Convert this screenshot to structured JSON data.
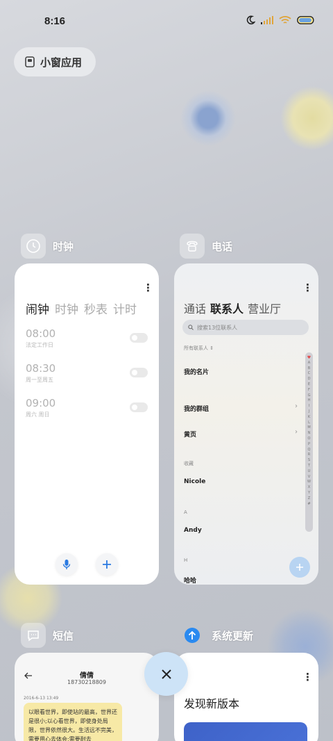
{
  "status": {
    "time": "8:16"
  },
  "floating_windows": {
    "label": "小窗应用"
  },
  "cards": {
    "clock": {
      "title": "时钟",
      "tabs": [
        "闹钟",
        "时钟",
        "秒表",
        "计时"
      ],
      "alarms": [
        {
          "time": "08:00",
          "repeat": "法定工作日"
        },
        {
          "time": "08:30",
          "repeat": "周一至周五"
        },
        {
          "time": "09:00",
          "repeat": "周六 周日"
        }
      ]
    },
    "phone": {
      "title": "电话",
      "tabs": [
        "通话",
        "联系人",
        "营业厅"
      ],
      "search_placeholder": "搜索13位联系人",
      "all_contacts": "所有联系人",
      "my_card": "我的名片",
      "my_groups": "我的群组",
      "yellow_pages": "黄页",
      "favorites_header": "收藏",
      "favorite_contact": "Nicole",
      "section_a": "A",
      "contact_a": "Andy",
      "section_h": "H",
      "contact_h": "哈哈",
      "index_letters": [
        "A",
        "B",
        "C",
        "D",
        "E",
        "F",
        "G",
        "H",
        "I",
        "J",
        "K",
        "L",
        "M",
        "N",
        "O",
        "P",
        "Q",
        "R",
        "S",
        "T",
        "U",
        "V",
        "W",
        "X",
        "Y",
        "Z",
        "#"
      ]
    },
    "sms": {
      "title": "短信",
      "contact_name": "倩倩",
      "contact_number": "18730218809",
      "date": "2016-6-13 13:49",
      "message": "以眼看世界，即使站的最高，世界还是很小;以心看世界，即使身处局限，世界依然很大。生活远不完美，需要用心去体会;需要耐去"
    },
    "update": {
      "title": "系统更新",
      "heading": "发现新版本"
    }
  },
  "colors": {
    "accent": "#2a7ae2",
    "close_button": "#cde3f7",
    "sms_bubble": "#f7e9a6"
  }
}
